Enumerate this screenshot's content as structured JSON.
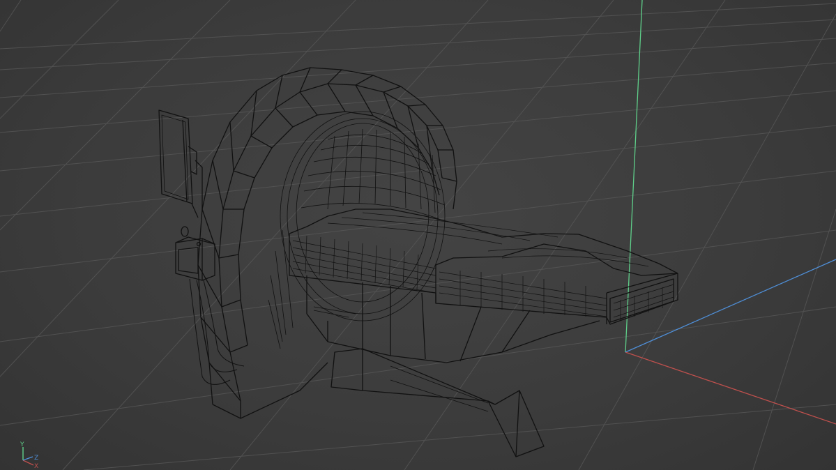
{
  "viewport": {
    "type": "3d-perspective-wireframe",
    "object": "ct-scanner-model",
    "colors": {
      "background": "#3b3b3b",
      "grid": "#555555",
      "wire": "#0f0f0f",
      "x_axis": "#c0504d",
      "y_axis": "#5fd08a",
      "z_axis": "#4f8fd8"
    }
  },
  "axis_gizmo": {
    "y": "Y",
    "z": "Z",
    "x": "X"
  }
}
